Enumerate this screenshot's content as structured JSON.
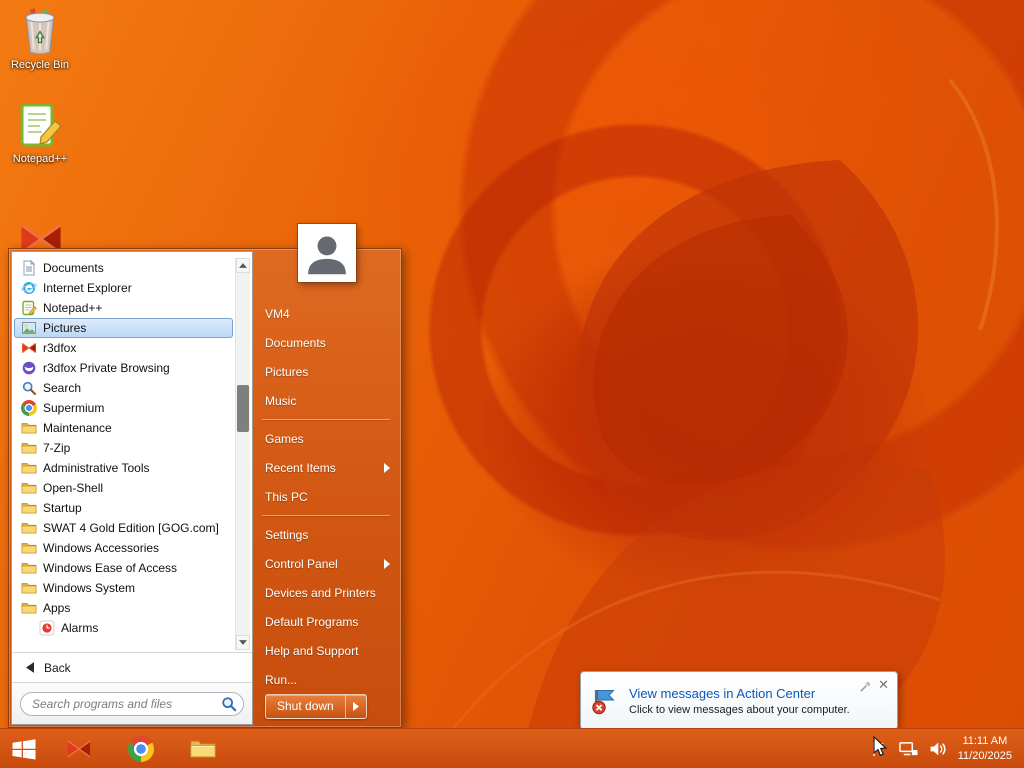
{
  "desktop": {
    "icons": [
      {
        "icon": "recycle-bin-icon",
        "label": "Recycle Bin"
      },
      {
        "icon": "notepadpp-desktop-icon",
        "label": "Notepad++"
      },
      {
        "icon": "r3dfox-icon",
        "label": ""
      }
    ]
  },
  "start_menu": {
    "left_items": [
      {
        "label": "Documents",
        "icon": "document-icon"
      },
      {
        "label": "Internet Explorer",
        "icon": "internet-explorer-icon"
      },
      {
        "label": "Notepad++",
        "icon": "notepadpp-icon"
      },
      {
        "label": "Pictures",
        "icon": "pictures-icon",
        "selected": true
      },
      {
        "label": "r3dfox",
        "icon": "r3dfox-icon"
      },
      {
        "label": "r3dfox Private Browsing",
        "icon": "private-browsing-icon"
      },
      {
        "label": "Search",
        "icon": "search-icon"
      },
      {
        "label": "Supermium",
        "icon": "supermium-icon"
      },
      {
        "label": "Maintenance",
        "icon": "folder-icon"
      },
      {
        "label": "7-Zip",
        "icon": "folder-icon"
      },
      {
        "label": "Administrative Tools",
        "icon": "folder-icon"
      },
      {
        "label": "Open-Shell",
        "icon": "folder-icon"
      },
      {
        "label": "Startup",
        "icon": "folder-icon"
      },
      {
        "label": "SWAT 4 Gold Edition [GOG.com]",
        "icon": "folder-icon"
      },
      {
        "label": "Windows Accessories",
        "icon": "folder-icon"
      },
      {
        "label": "Windows Ease of Access",
        "icon": "folder-icon"
      },
      {
        "label": "Windows System",
        "icon": "folder-icon"
      },
      {
        "label": "Apps",
        "icon": "folder-icon"
      },
      {
        "label": "Alarms",
        "icon": "alarms-icon",
        "indent": true
      }
    ],
    "back_label": "Back",
    "search_placeholder": "Search programs and files",
    "right_items": [
      {
        "label": "VM4"
      },
      {
        "label": "Documents"
      },
      {
        "label": "Pictures"
      },
      {
        "label": "Music"
      },
      {
        "separator": true
      },
      {
        "label": "Games"
      },
      {
        "label": "Recent Items",
        "submenu": true
      },
      {
        "label": "This PC"
      },
      {
        "separator": true
      },
      {
        "label": "Settings"
      },
      {
        "label": "Control Panel",
        "submenu": true
      },
      {
        "label": "Devices and Printers"
      },
      {
        "label": "Default Programs"
      },
      {
        "label": "Help and Support"
      },
      {
        "label": "Run..."
      }
    ],
    "shutdown_label": "Shut down"
  },
  "taskbar": {
    "start": {
      "icon": "windows-logo-icon"
    },
    "pinned": [
      {
        "icon": "r3dfox-icon"
      },
      {
        "icon": "supermium-icon"
      },
      {
        "icon": "file-explorer-icon"
      }
    ],
    "tray": [
      {
        "icon": "action-center-flag-icon"
      },
      {
        "icon": "network-icon"
      },
      {
        "icon": "volume-icon"
      }
    ],
    "clock": {
      "time": "11:11 AM",
      "date": "11/20/2025"
    }
  },
  "notification": {
    "title": "View messages in Action Center",
    "body": "Click to view messages about your computer."
  },
  "colors": {
    "accent_orange": "#d15712",
    "selection_blue": "#7da2ce",
    "link_blue": "#0a58b8"
  }
}
